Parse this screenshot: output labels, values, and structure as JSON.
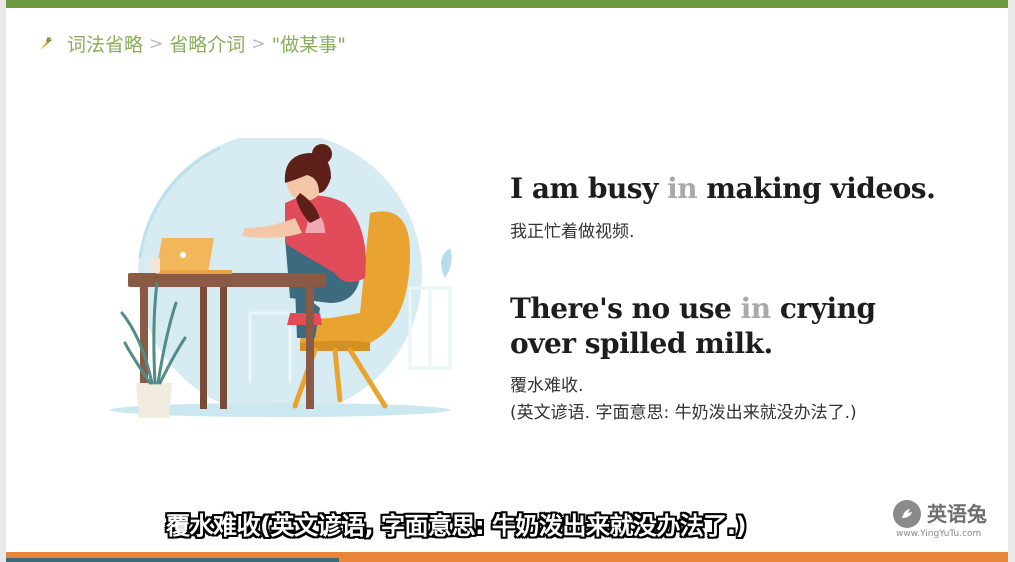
{
  "breadcrumb": {
    "items": [
      "词法省略",
      "省略介词",
      "\"做某事\""
    ],
    "separator": ">"
  },
  "sentence1": {
    "before": "I am busy ",
    "highlight": "in",
    "after": " making videos.",
    "translation": "我正忙着做视频."
  },
  "sentence2": {
    "line1_before": "There's no use ",
    "line1_highlight": "in",
    "line1_after": " crying",
    "line2": "over spilled milk.",
    "translation_line1": "覆水难收.",
    "translation_line2": "(英文谚语. 字面意思: 牛奶泼出来就没办法了.)"
  },
  "subtitle": "覆水难收(英文谚语, 字面意思: 牛奶泼出来就没办法了.)",
  "logo": {
    "name": "英语兔",
    "url": "www.YingYuTu.com",
    "icon": "rabbit-icon"
  },
  "colors": {
    "top_bar": "#6b9a3f",
    "bottom_bar": "#e9863a",
    "breadcrumb": "#8cad5d",
    "highlight": "#a9a9a9"
  }
}
